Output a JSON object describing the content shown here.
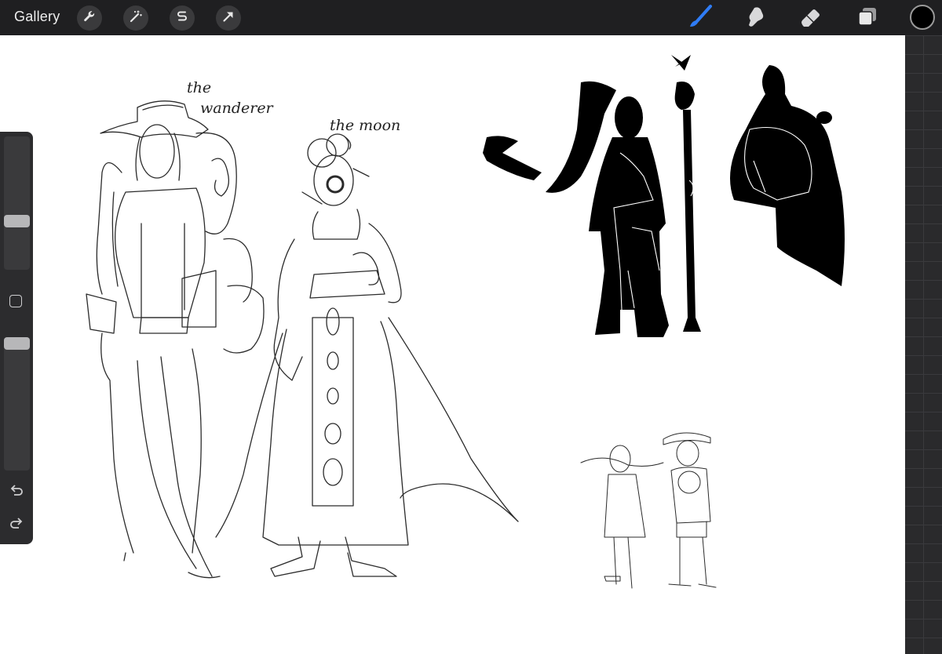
{
  "topbar": {
    "gallery_label": "Gallery",
    "left_tools": [
      {
        "name": "actions",
        "icon": "wrench-icon"
      },
      {
        "name": "adjustments",
        "icon": "magic-wand-icon"
      },
      {
        "name": "selection",
        "icon": "selection-s-icon"
      },
      {
        "name": "transform",
        "icon": "arrow-cursor-icon"
      }
    ],
    "right_tools": [
      {
        "name": "brush",
        "icon": "brush-icon",
        "active": true
      },
      {
        "name": "smudge",
        "icon": "smudge-icon"
      },
      {
        "name": "eraser",
        "icon": "eraser-icon"
      },
      {
        "name": "layers",
        "icon": "layers-icon"
      }
    ],
    "current_color": "#000000",
    "accent_color": "#2f7cf6"
  },
  "sidebar": {
    "brush_size_level": 0.35,
    "opacity_level": 1.0,
    "modify_icon": "square-icon",
    "undo_icon": "undo-icon",
    "redo_icon": "redo-icon"
  },
  "canvas": {
    "label_wanderer_line1": "the",
    "label_wanderer_line2": "wanderer",
    "label_moon": "the moon"
  }
}
